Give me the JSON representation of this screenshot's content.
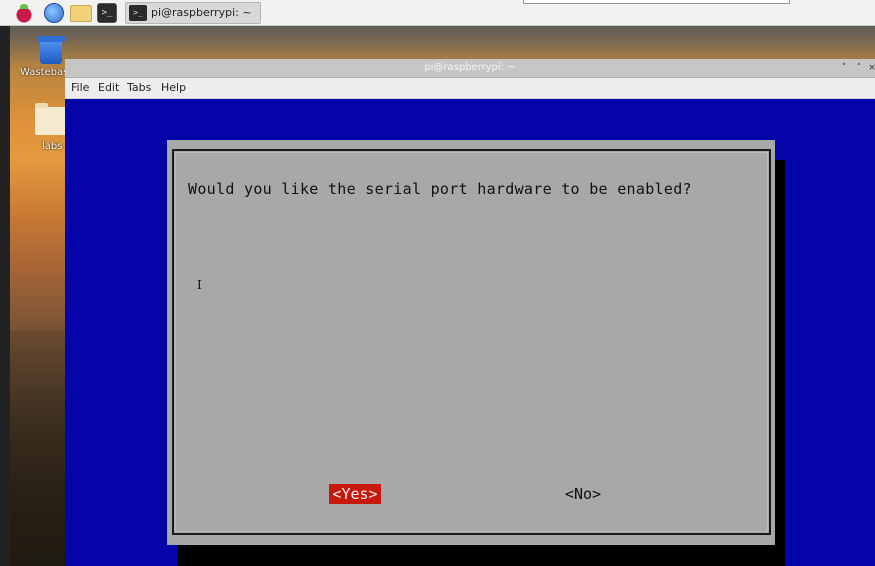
{
  "taskbar": {
    "task_label": "pi@raspberrypi: ~",
    "terminal_glyph": ">_"
  },
  "desktop": {
    "trash_label": "Wastebasket",
    "folder_label": "labs"
  },
  "window": {
    "title": "pi@raspberrypi: ~",
    "controls": {
      "minimize": "˅",
      "maximize": "˄",
      "close": "×"
    },
    "menu": [
      "File",
      "Edit",
      "Tabs",
      "Help"
    ]
  },
  "dialog": {
    "question": "Would you like the serial port hardware to be enabled?",
    "cursor_glyph": "I",
    "yes_label": "<Yes>",
    "no_label": "<No>",
    "selected": "yes"
  },
  "colors": {
    "terminal_background": "#0404a8",
    "dialog_background": "#a8a8a8",
    "selected_button": "#c8170c"
  }
}
